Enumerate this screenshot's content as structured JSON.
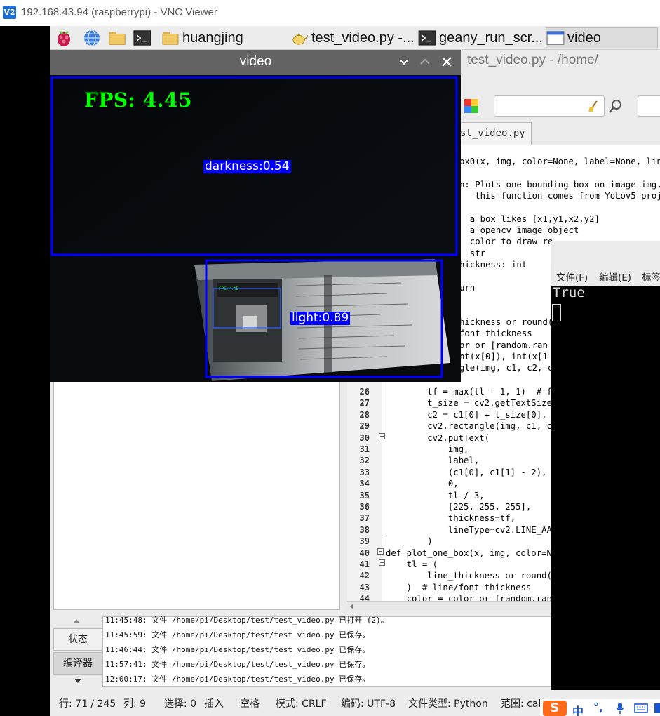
{
  "vnc": {
    "logo": "V2",
    "title": "192.168.43.94 (raspberrypi) - VNC Viewer"
  },
  "taskbar": {
    "launchers": [
      "raspberry-menu-icon",
      "browser-globe-icon",
      "file-manager-icon",
      "terminal-icon"
    ],
    "tasks": [
      {
        "icon": "folder-icon",
        "label": "huangjing"
      },
      {
        "icon": "geany-teapot-icon",
        "label": "test_video.py -..."
      },
      {
        "icon": "terminal-icon",
        "label": "geany_run_scr..."
      },
      {
        "icon": "window-icon",
        "label": "video"
      }
    ]
  },
  "geany": {
    "title": "test_video.py - /home/",
    "tab_label": "st_video.py",
    "tab_close": "✖",
    "code_top": [
      {
        "t": "ox0(x, img, color=None, label=None, line"
      },
      {
        "t": ""
      },
      {
        "t": "n: Plots one bounding box on image img,"
      },
      {
        "t": "   this function comes from YoLov5 proje"
      },
      {
        "t": ""
      },
      {
        "t": "  a box likes [x1,y1,x2,y2]"
      },
      {
        "t": "  a opencv image object"
      },
      {
        "t": "  color to draw re"
      },
      {
        "t": "  str"
      },
      {
        "t": "hickness: int"
      },
      {
        "t": ""
      },
      {
        "t": "urn"
      },
      {
        "t": ""
      },
      {
        "t": ""
      },
      {
        "t": "hickness or round("
      },
      {
        "t": "font thickness"
      },
      {
        "t": "or or [random.ran"
      },
      {
        "t": "nt(x[0]), int(x[1"
      },
      {
        "t": "gle(img, c1, c2, c"
      }
    ],
    "line_numbers": [
      "26",
      "27",
      "28",
      "29",
      "30",
      "31",
      "32",
      "33",
      "34",
      "35",
      "36",
      "37",
      "38",
      "39",
      "40",
      "41",
      "42",
      "43",
      "44"
    ],
    "code_bottom": [
      "        tf = max(tl - 1, 1)  # f",
      "        t_size = cv2.getTextSize",
      "        c2 = c1[0] + t_size[0],",
      "        cv2.rectangle(img, c1, c",
      "        cv2.putText(",
      "            img,",
      "            label,",
      "            (c1[0], c1[1] - 2),",
      "            0,",
      "            tl / 3,",
      "            [225, 255, 255],",
      "            thickness=tf,",
      "            lineType=cv2.LINE_AA",
      "        )",
      "def plot_one_box(x, img, color=N",
      "    tl = (",
      "        line_thickness or round(",
      "    )  # line/font thickness",
      "    color = color or [random.ran"
    ],
    "msg_tabs": [
      "状态",
      "编译器"
    ],
    "messages": [
      "11:45:48: 文件 /home/pi/Desktop/test/test_video.py 已打开 (2)。",
      "11:45:59: 文件 /home/pi/Desktop/test/test_video.py 已保存。",
      "11:46:44: 文件 /home/pi/Desktop/test/test_video.py 已保存。",
      "11:57:41: 文件 /home/pi/Desktop/test/test_video.py 已保存。",
      "12:00:17: 文件 /home/pi/Desktop/test/test_video.py 已保存。"
    ],
    "status": {
      "line": "行: 71 / 245",
      "col": "列: 9",
      "sel": "选择: 0",
      "ins": "插入",
      "space": "空格",
      "mode": "模式: CRLF",
      "enc": "编码: UTF-8",
      "ftype": "文件类型: Python",
      "scope": "范围: cal"
    }
  },
  "terminal": {
    "menu": [
      "文件(F)",
      "编辑(E)",
      "标签"
    ],
    "output": "True"
  },
  "ime": {
    "items": [
      "中",
      "°,",
      "mic-icon",
      "keyboard-icon"
    ]
  },
  "video": {
    "title": "video",
    "fps": "FPS: 4.45",
    "detections": [
      {
        "label": "darkness:0.54",
        "color": "#0000ff"
      },
      {
        "label": "light:0.89",
        "color": "#0000ff"
      }
    ],
    "inner_fps": "FPS: 4.45"
  }
}
